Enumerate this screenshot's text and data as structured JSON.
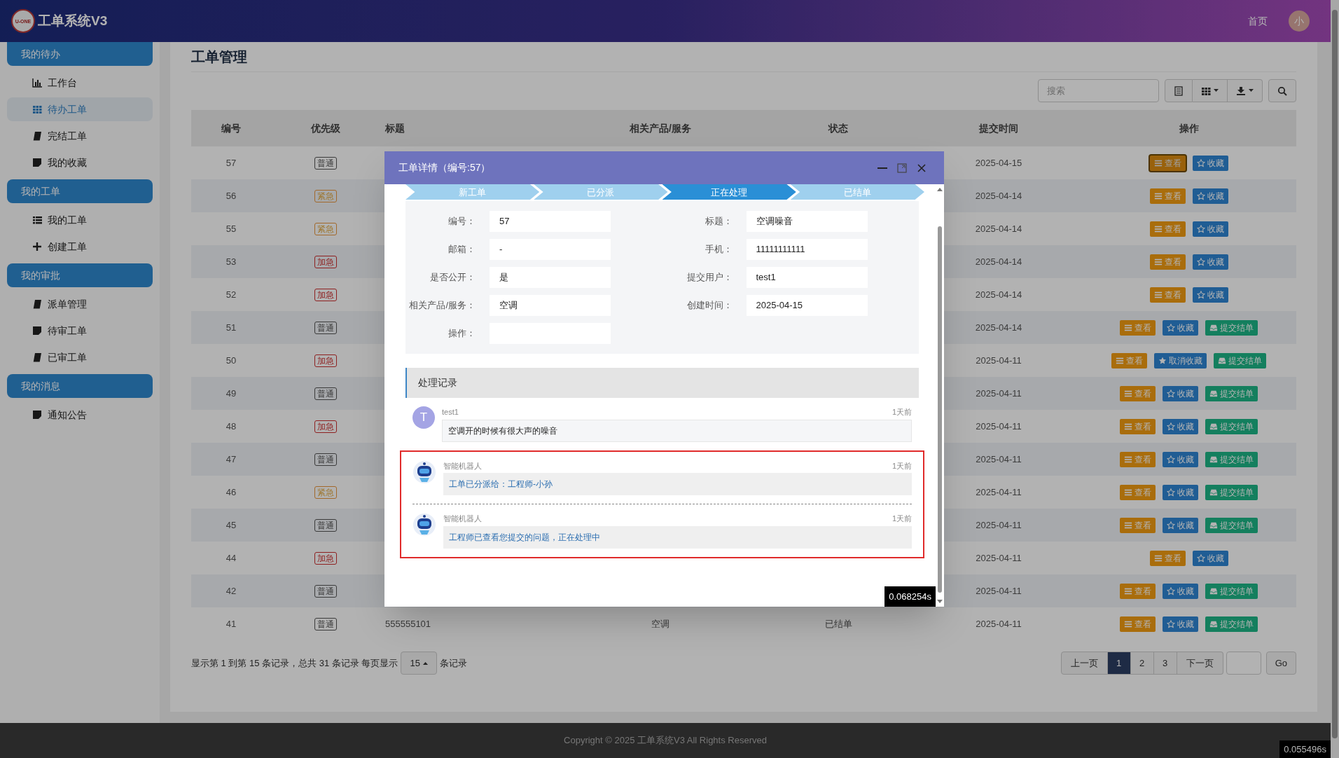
{
  "app": {
    "logo_text": "U-ONE",
    "title": "工单系统V3",
    "nav_home": "首页",
    "avatar": "小"
  },
  "sidebar": {
    "groups": [
      {
        "label": "我的待办",
        "items": [
          {
            "label": "工作台",
            "kind": "chart",
            "selected": false
          },
          {
            "label": "待办工单",
            "kind": "grid",
            "selected": true
          },
          {
            "label": "完结工单",
            "kind": "book",
            "selected": false
          },
          {
            "label": "我的收藏",
            "kind": "note",
            "selected": false
          }
        ]
      },
      {
        "label": "我的工单",
        "items": [
          {
            "label": "我的工单",
            "kind": "list",
            "selected": false
          },
          {
            "label": "创建工单",
            "kind": "plus",
            "selected": false
          }
        ]
      },
      {
        "label": "我的审批",
        "items": [
          {
            "label": "派单管理",
            "kind": "book",
            "selected": false
          },
          {
            "label": "待审工单",
            "kind": "note",
            "selected": false
          },
          {
            "label": "已审工单",
            "kind": "book",
            "selected": false
          }
        ]
      },
      {
        "label": "我的消息",
        "items": [
          {
            "label": "通知公告",
            "kind": "note",
            "selected": false
          }
        ]
      }
    ]
  },
  "page_title": "工单管理",
  "toolbar": {
    "search": {
      "placeholder": "搜索"
    }
  },
  "table": {
    "columns": [
      "编号",
      "优先级",
      "标题",
      "相关产品/服务",
      "状态",
      "提交时间",
      "操作"
    ],
    "rows": [
      {
        "id": "57",
        "priority": {
          "label": "普通",
          "kind": "normal"
        },
        "time": "2025-04-15",
        "actions": [
          {
            "kind": "view",
            "label": "查看",
            "focused": true
          },
          {
            "kind": "fav",
            "label": "收藏",
            "focused": false
          }
        ]
      },
      {
        "id": "56",
        "priority": {
          "label": "紧急",
          "kind": "urgent"
        },
        "time": "2025-04-14",
        "actions": [
          {
            "kind": "view",
            "label": "查看",
            "focused": false
          },
          {
            "kind": "fav",
            "label": "收藏",
            "focused": false
          }
        ]
      },
      {
        "id": "55",
        "priority": {
          "label": "紧急",
          "kind": "urgent"
        },
        "time": "2025-04-14",
        "actions": [
          {
            "kind": "view",
            "label": "查看",
            "focused": false
          },
          {
            "kind": "fav",
            "label": "收藏",
            "focused": false
          }
        ]
      },
      {
        "id": "53",
        "priority": {
          "label": "加急",
          "kind": "critical"
        },
        "time": "2025-04-14",
        "actions": [
          {
            "kind": "view",
            "label": "查看",
            "focused": false
          },
          {
            "kind": "fav",
            "label": "收藏",
            "focused": false
          }
        ]
      },
      {
        "id": "52",
        "priority": {
          "label": "加急",
          "kind": "critical"
        },
        "time": "2025-04-14",
        "actions": [
          {
            "kind": "view",
            "label": "查看",
            "focused": false
          },
          {
            "kind": "fav",
            "label": "收藏",
            "focused": false
          }
        ]
      },
      {
        "id": "51",
        "priority": {
          "label": "普通",
          "kind": "normal"
        },
        "time": "2025-04-14",
        "actions": [
          {
            "kind": "view",
            "label": "查看",
            "focused": false
          },
          {
            "kind": "fav",
            "label": "收藏",
            "focused": false
          },
          {
            "kind": "submit",
            "label": "提交结单",
            "focused": false
          }
        ]
      },
      {
        "id": "50",
        "priority": {
          "label": "加急",
          "kind": "critical"
        },
        "time": "2025-04-11",
        "actions": [
          {
            "kind": "view",
            "label": "查看",
            "focused": false
          },
          {
            "kind": "unfav",
            "label": "取消收藏",
            "focused": false
          },
          {
            "kind": "submit",
            "label": "提交结单",
            "focused": false
          }
        ]
      },
      {
        "id": "49",
        "priority": {
          "label": "普通",
          "kind": "normal"
        },
        "time": "2025-04-11",
        "actions": [
          {
            "kind": "view",
            "label": "查看",
            "focused": false
          },
          {
            "kind": "fav",
            "label": "收藏",
            "focused": false
          },
          {
            "kind": "submit",
            "label": "提交结单",
            "focused": false
          }
        ]
      },
      {
        "id": "48",
        "priority": {
          "label": "加急",
          "kind": "critical"
        },
        "time": "2025-04-11",
        "actions": [
          {
            "kind": "view",
            "label": "查看",
            "focused": false
          },
          {
            "kind": "fav",
            "label": "收藏",
            "focused": false
          },
          {
            "kind": "submit",
            "label": "提交结单",
            "focused": false
          }
        ]
      },
      {
        "id": "47",
        "priority": {
          "label": "普通",
          "kind": "normal"
        },
        "time": "2025-04-11",
        "actions": [
          {
            "kind": "view",
            "label": "查看",
            "focused": false
          },
          {
            "kind": "fav",
            "label": "收藏",
            "focused": false
          },
          {
            "kind": "submit",
            "label": "提交结单",
            "focused": false
          }
        ]
      },
      {
        "id": "46",
        "priority": {
          "label": "紧急",
          "kind": "urgent"
        },
        "time": "2025-04-11",
        "actions": [
          {
            "kind": "view",
            "label": "查看",
            "focused": false
          },
          {
            "kind": "fav",
            "label": "收藏",
            "focused": false
          },
          {
            "kind": "submit",
            "label": "提交结单",
            "focused": false
          }
        ]
      },
      {
        "id": "45",
        "priority": {
          "label": "普通",
          "kind": "normal"
        },
        "time": "2025-04-11",
        "actions": [
          {
            "kind": "view",
            "label": "查看",
            "focused": false
          },
          {
            "kind": "fav",
            "label": "收藏",
            "focused": false
          },
          {
            "kind": "submit",
            "label": "提交结单",
            "focused": false
          }
        ]
      },
      {
        "id": "44",
        "priority": {
          "label": "加急",
          "kind": "critical"
        },
        "time": "2025-04-11",
        "actions": [
          {
            "kind": "view",
            "label": "查看",
            "focused": false
          },
          {
            "kind": "fav",
            "label": "收藏",
            "focused": false
          }
        ]
      },
      {
        "id": "42",
        "priority": {
          "label": "普通",
          "kind": "normal"
        },
        "time": "2025-04-11",
        "actions": [
          {
            "kind": "view",
            "label": "查看",
            "focused": false
          },
          {
            "kind": "fav",
            "label": "收藏",
            "focused": false
          },
          {
            "kind": "submit",
            "label": "提交结单",
            "focused": false
          }
        ]
      },
      {
        "id": "41",
        "priority": {
          "label": "普通",
          "kind": "normal"
        },
        "title": "555555101",
        "product": "空调",
        "status": "已结单",
        "time": "2025-04-11",
        "actions": [
          {
            "kind": "view",
            "label": "查看",
            "focused": false
          },
          {
            "kind": "fav",
            "label": "收藏",
            "focused": false
          },
          {
            "kind": "submit",
            "label": "提交结单",
            "focused": false
          }
        ]
      }
    ]
  },
  "pagination": {
    "info": "显示第 1 到第 15 条记录，总共 31 条记录 每页显示",
    "page_size": "15",
    "suffix": "条记录",
    "prev": "上一页",
    "pages": [
      {
        "label": "1",
        "selected": true
      },
      {
        "label": "2",
        "selected": false
      },
      {
        "label": "3",
        "selected": false
      }
    ],
    "next": "下一页",
    "go": "Go"
  },
  "footer": {
    "copyright": "Copyright © 2025 工单系统V3 All Rights Reserved",
    "timing": "0.055496s"
  },
  "modal": {
    "title": "工单详情（编号:57）",
    "steps": [
      {
        "label": "新工单",
        "current": false
      },
      {
        "label": "已分派",
        "current": false
      },
      {
        "label": "正在处理",
        "current": true
      },
      {
        "label": "已结单",
        "current": false
      }
    ],
    "fields": [
      {
        "label": "编号：",
        "value": "57"
      },
      {
        "label": "标题：",
        "value": "空调噪音"
      },
      {
        "label": "邮箱：",
        "value": "-"
      },
      {
        "label": "手机：",
        "value": "11111111111"
      },
      {
        "label": "是否公开：",
        "value": "是"
      },
      {
        "label": "提交用户：",
        "value": "test1"
      },
      {
        "label": "相关产品/服务：",
        "value": "空调"
      },
      {
        "label": "创建时间：",
        "value": "2025-04-15"
      },
      {
        "label": "操作："
      }
    ],
    "records_title": "处理记录",
    "records": [
      {
        "kind": "user",
        "avatar": "T",
        "user": "test1",
        "time": "1天前",
        "text": "空调开的时候有很大声的噪音",
        "highlighted": false
      },
      {
        "kind": "robot",
        "user": "智能机器人",
        "time": "1天前",
        "text": "工单已分派给：工程师-小孙",
        "highlighted": true
      },
      {
        "kind": "robot",
        "user": "智能机器人",
        "time": "1天前",
        "text": "工程师已查看您提交的问题，正在处理中",
        "highlighted": true
      }
    ],
    "timing": "0.068254s"
  }
}
